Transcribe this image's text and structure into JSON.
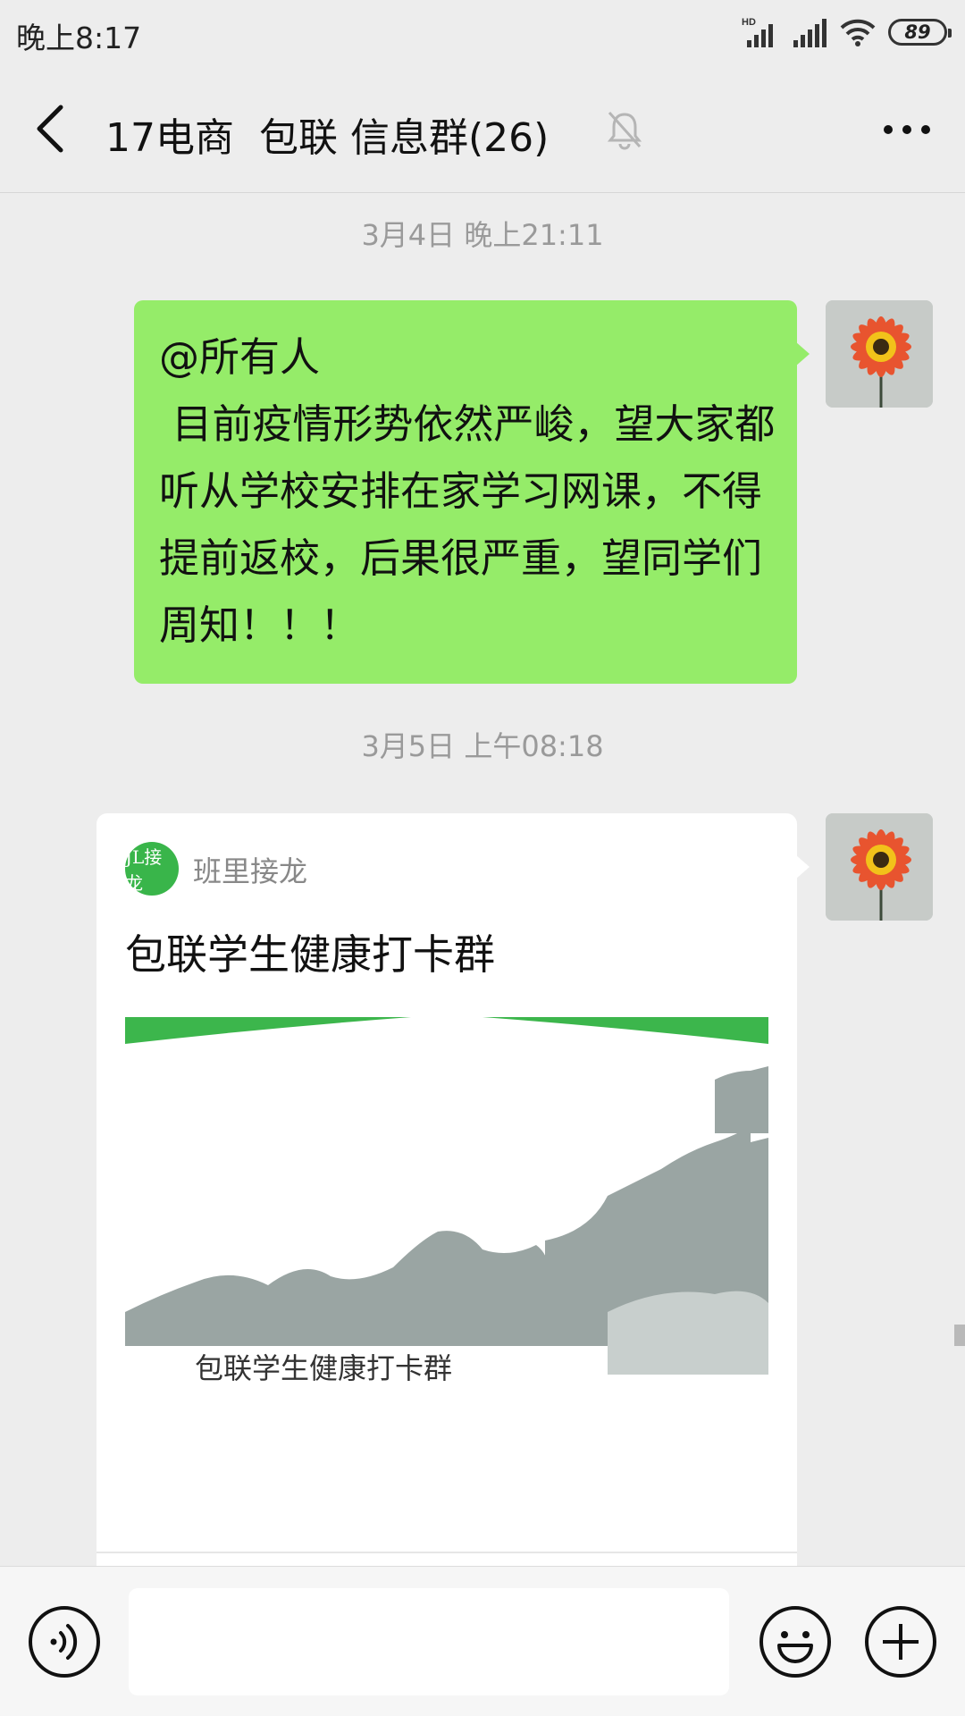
{
  "status_bar": {
    "time": "晚上8:17",
    "battery": "89",
    "network_label": "HD",
    "icons": [
      "signal-icon",
      "signal-icon",
      "wifi-icon",
      "battery-icon"
    ]
  },
  "header": {
    "title": "17电商  包联 信息群(26)",
    "back_icon": "back-arrow-icon",
    "mute_icon": "bell-muted-icon",
    "more_icon": "more-dots-icon"
  },
  "messages": [
    {
      "timestamp": "3月4日 晚上21:11",
      "type": "text",
      "sender": "self",
      "text": "@所有人\n 目前疫情形势依然严峻，望大家都听从学校安排在家学习网课，不得提前返校，后果很严重，望同学们周知！！！"
    },
    {
      "timestamp": "3月5日 上午08:18",
      "type": "card",
      "sender": "self",
      "app_logo_text": "JL接龙",
      "app_name": "班里接龙",
      "title": "包联学生健康打卡群",
      "caption": "包联学生健康打卡群"
    }
  ],
  "input_bar": {
    "voice_icon": "voice-icon",
    "input_value": "",
    "emoji_icon": "emoji-icon",
    "plus_icon": "plus-icon"
  },
  "colors": {
    "background": "#ededed",
    "bubble_self": "#95ec69",
    "card_green": "#39b54a",
    "timestamp": "#9a9a9a"
  }
}
